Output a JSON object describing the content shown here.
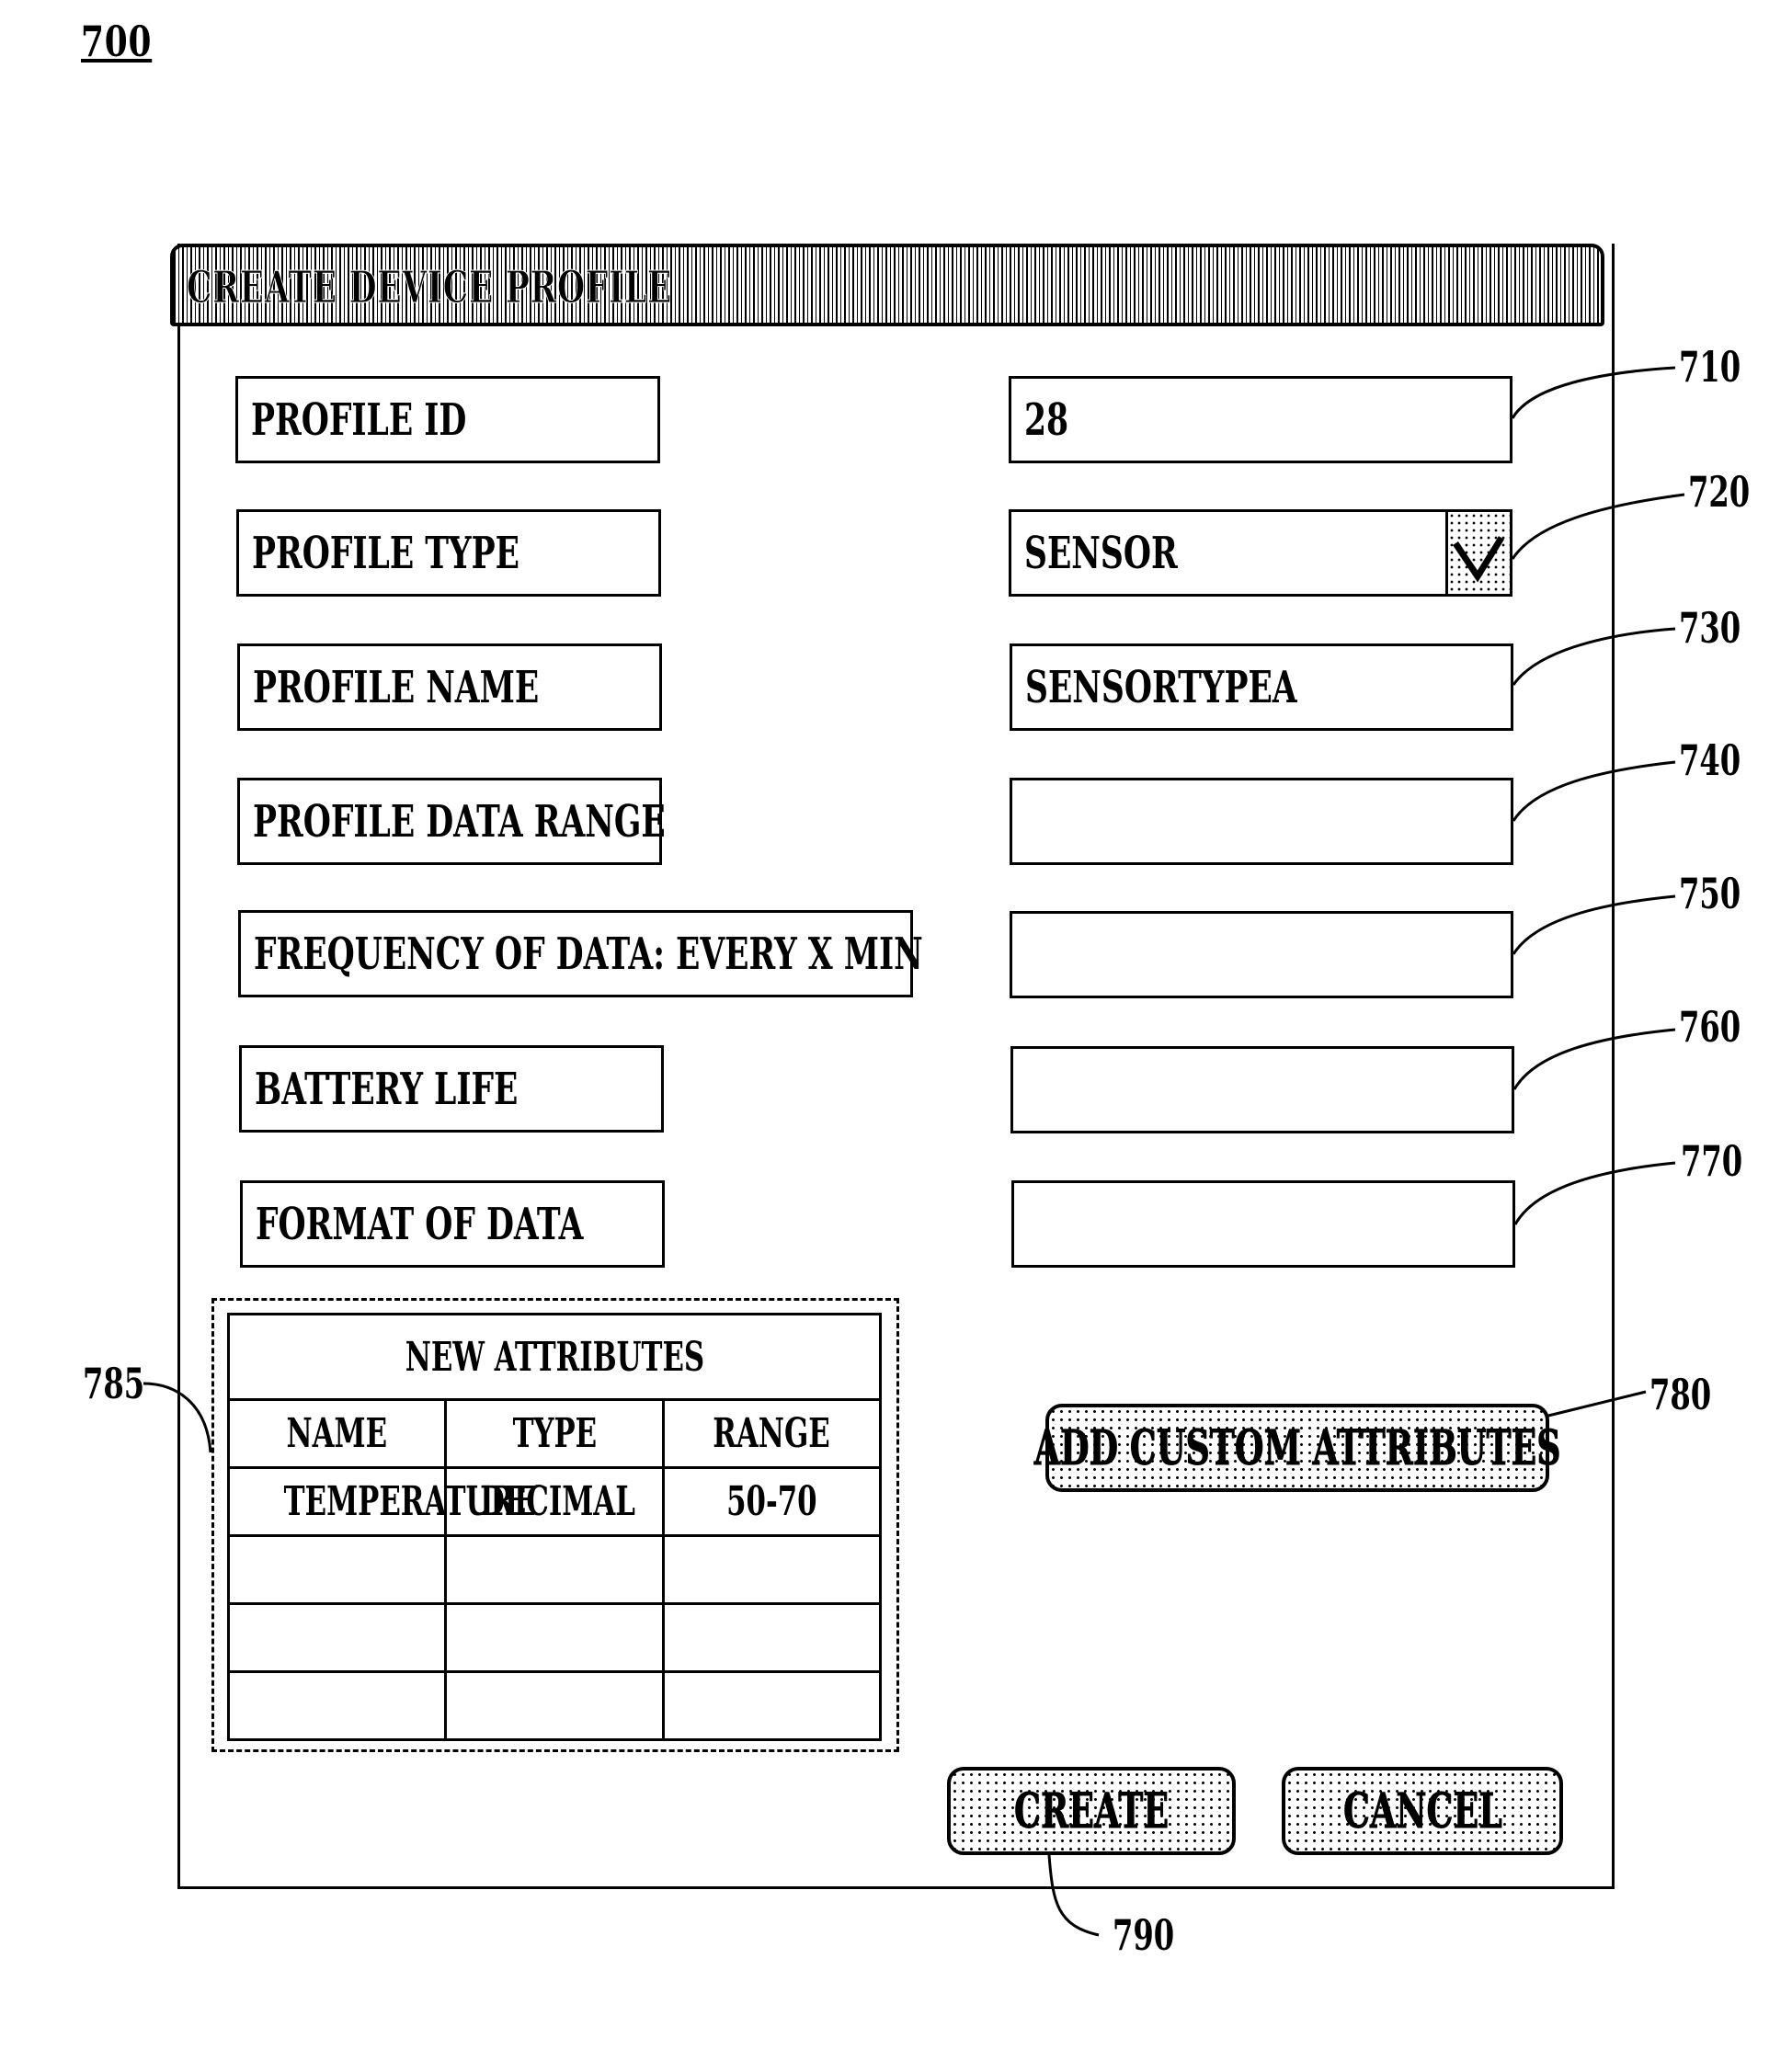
{
  "figure_label": "700",
  "dialog": {
    "title": "CREATE DEVICE PROFILE"
  },
  "fields": [
    {
      "label": "PROFILE ID",
      "value": "28",
      "ref": "710",
      "kind": "text"
    },
    {
      "label": "PROFILE TYPE",
      "value": "SENSOR",
      "ref": "720",
      "kind": "dropdown"
    },
    {
      "label": "PROFILE NAME",
      "value": "SENSORTYPEA",
      "ref": "730",
      "kind": "text"
    },
    {
      "label": "PROFILE DATA RANGE",
      "value": "",
      "ref": "740",
      "kind": "text"
    },
    {
      "label": "FREQUENCY OF DATA: EVERY X MIN",
      "value": "",
      "ref": "750",
      "kind": "text"
    },
    {
      "label": "BATTERY LIFE",
      "value": "",
      "ref": "760",
      "kind": "text"
    },
    {
      "label": "FORMAT OF DATA",
      "value": "",
      "ref": "770",
      "kind": "text"
    }
  ],
  "attributes_table": {
    "ref": "785",
    "title": "NEW ATTRIBUTES",
    "columns": [
      "NAME",
      "TYPE",
      "RANGE"
    ],
    "rows": [
      [
        "TEMPERATURE",
        "DECIMAL",
        "50-70"
      ],
      [
        "",
        "",
        ""
      ],
      [
        "",
        "",
        ""
      ],
      [
        "",
        "",
        ""
      ]
    ]
  },
  "buttons": {
    "add_custom_attributes": {
      "label": "ADD CUSTOM ATTRIBUTES",
      "ref": "780"
    },
    "create": {
      "label": "CREATE",
      "ref": "790"
    },
    "cancel": {
      "label": "CANCEL"
    }
  },
  "icons": {
    "dropdown": "chevron-down-icon"
  }
}
